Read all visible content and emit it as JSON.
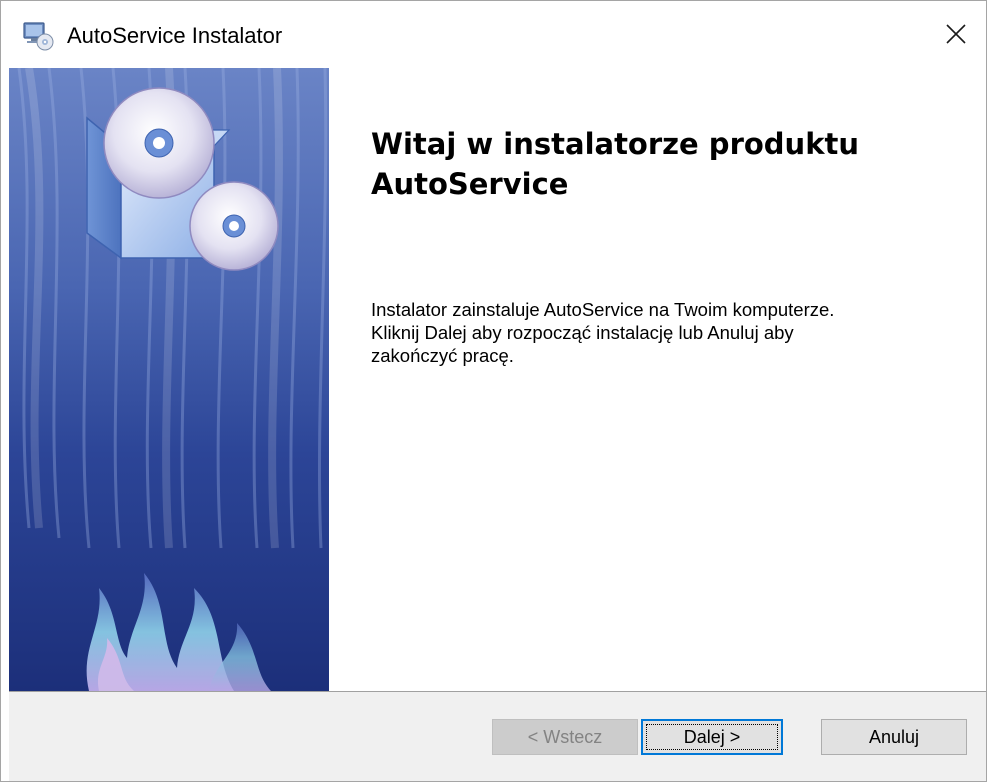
{
  "window": {
    "title": "AutoService Instalator",
    "title_icon": "installer-computer-cd-icon",
    "close_icon": "close-icon"
  },
  "side_panel": {
    "image": "installer-banner-box-cds-flames"
  },
  "content": {
    "heading": "Witaj w instalatorze produktu AutoService",
    "body_lines": [
      "Instalator zainstaluje AutoService na Twoim komputerze.",
      "Kliknij Dalej aby rozpocząć instalację lub Anuluj aby",
      "zakończyć pracę."
    ]
  },
  "buttons": {
    "back": {
      "label": "< Wstecz",
      "enabled": false
    },
    "next": {
      "label": "Dalej >",
      "enabled": true,
      "focused": true
    },
    "cancel": {
      "label": "Anuluj",
      "enabled": true
    }
  },
  "colors": {
    "panel_blue": "#2f4aa3",
    "focus_border": "#0078d7",
    "footer_bg": "#f0f0f0"
  }
}
